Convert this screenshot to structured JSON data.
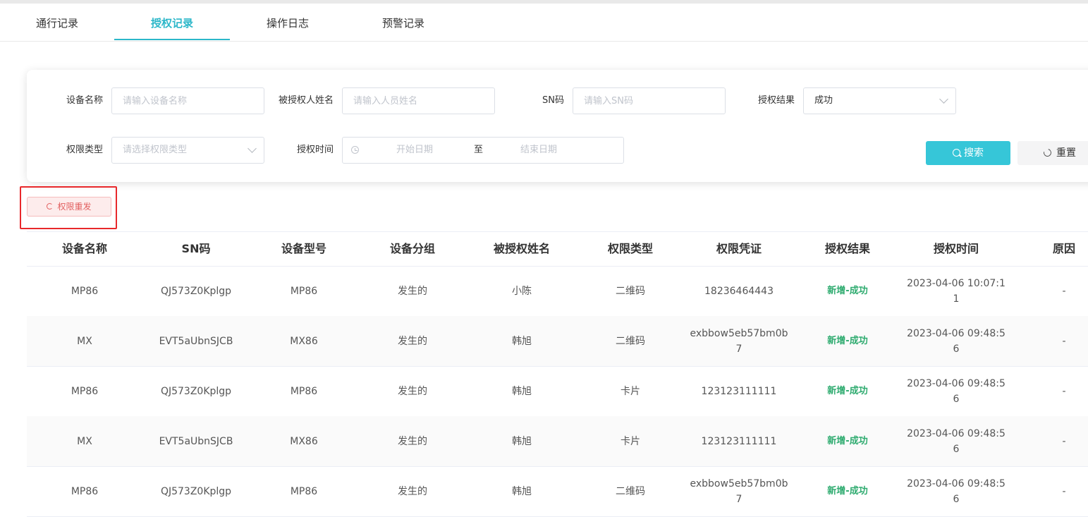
{
  "tabs": [
    {
      "label": "通行记录"
    },
    {
      "label": "授权记录"
    },
    {
      "label": "操作日志"
    },
    {
      "label": "预警记录"
    }
  ],
  "active_tab": "授权记录",
  "filters": {
    "device_name": {
      "label": "设备名称",
      "placeholder": "请输入设备名称"
    },
    "person_name": {
      "label": "被授权人姓名",
      "placeholder": "请输入人员姓名"
    },
    "sn": {
      "label": "SN码",
      "placeholder": "请输入SN码"
    },
    "result": {
      "label": "授权结果",
      "value": "成功"
    },
    "perm_type": {
      "label": "权限类型",
      "placeholder": "请选择权限类型"
    },
    "auth_time": {
      "label": "授权时间",
      "start": "开始日期",
      "separator": "至",
      "end": "结束日期"
    }
  },
  "buttons": {
    "search": "搜索",
    "reset": "重置",
    "resend": "权限重发"
  },
  "colors": {
    "accent": "#36c6d8",
    "tab_active": "#2cb7c9",
    "success": "#2eab6f",
    "highlight_box": "#e8282b"
  },
  "table": {
    "headers": [
      "设备名称",
      "SN码",
      "设备型号",
      "设备分组",
      "被授权姓名",
      "权限类型",
      "权限凭证",
      "授权结果",
      "授权时间",
      "原因"
    ],
    "rows": [
      [
        "MP86",
        "QJ573Z0Kplgp",
        "MP86",
        "发生的",
        "小陈",
        "二维码",
        "18236464443",
        "新增-成功",
        "2023-04-06 10:07:11",
        "-"
      ],
      [
        "MX",
        "EVT5aUbnSJCB",
        "MX86",
        "发生的",
        "韩旭",
        "二维码",
        "exbbow5eb57bm0b7",
        "新增-成功",
        "2023-04-06 09:48:56",
        "-"
      ],
      [
        "MP86",
        "QJ573Z0Kplgp",
        "MP86",
        "发生的",
        "韩旭",
        "卡片",
        "123123111111",
        "新增-成功",
        "2023-04-06 09:48:56",
        "-"
      ],
      [
        "MX",
        "EVT5aUbnSJCB",
        "MX86",
        "发生的",
        "韩旭",
        "卡片",
        "123123111111",
        "新增-成功",
        "2023-04-06 09:48:56",
        "-"
      ],
      [
        "MP86",
        "QJ573Z0Kplgp",
        "MP86",
        "发生的",
        "韩旭",
        "二维码",
        "exbbow5eb57bm0b7",
        "新增-成功",
        "2023-04-06 09:48:56",
        "-"
      ]
    ]
  }
}
